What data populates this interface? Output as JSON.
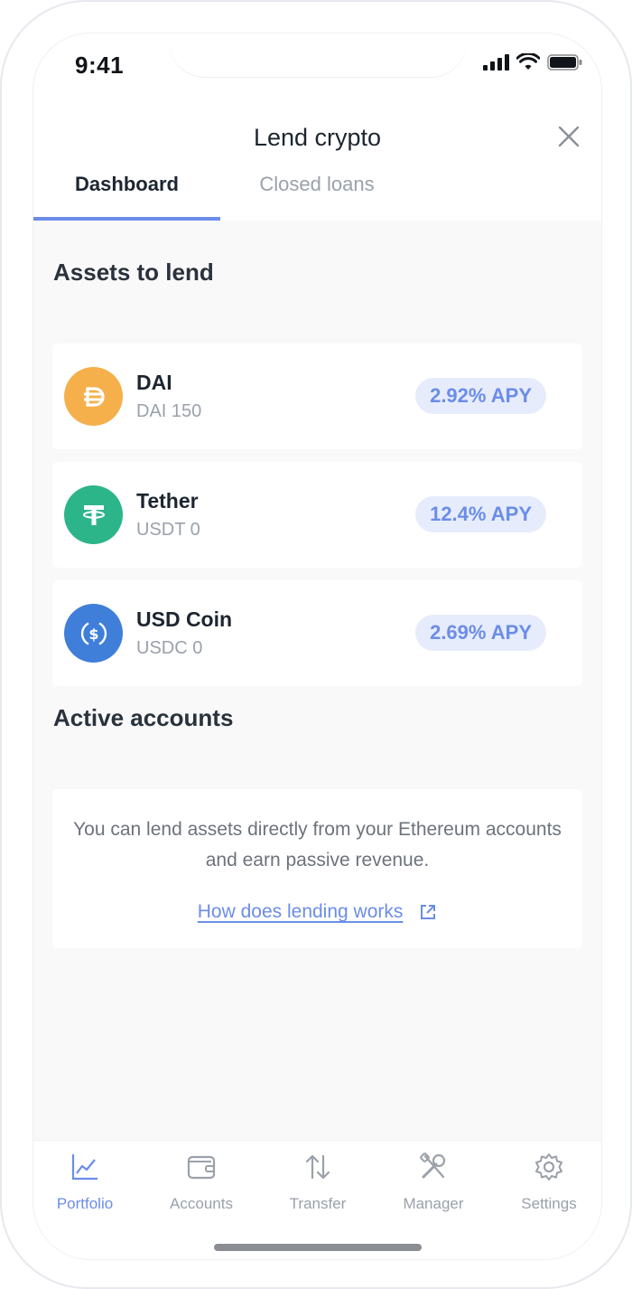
{
  "status_bar": {
    "time": "9:41"
  },
  "header": {
    "title": "Lend crypto",
    "tabs": [
      {
        "label": "Dashboard",
        "active": true
      },
      {
        "label": "Closed loans",
        "active": false
      }
    ]
  },
  "assets_section": {
    "title": "Assets to lend",
    "items": [
      {
        "name": "DAI",
        "balance": "DAI 150",
        "apy": "2.92% APY",
        "icon": "dai-icon",
        "color": "#f5b04c"
      },
      {
        "name": "Tether",
        "balance": "USDT 0",
        "apy": "12.4% APY",
        "icon": "tether-icon",
        "color": "#2db58a"
      },
      {
        "name": "USD Coin",
        "balance": "USDC 0",
        "apy": "2.69% APY",
        "icon": "usd-coin-icon",
        "color": "#3f7fd9"
      }
    ]
  },
  "active_section": {
    "title": "Active accounts",
    "description": "You can lend assets directly from your Ethereum accounts and earn passive revenue.",
    "link_label": "How does lending works"
  },
  "bottom_nav": {
    "items": [
      {
        "label": "Portfolio",
        "icon": "chart-icon",
        "active": true
      },
      {
        "label": "Accounts",
        "icon": "wallet-icon",
        "active": false
      },
      {
        "label": "Transfer",
        "icon": "transfer-arrows-icon",
        "active": false
      },
      {
        "label": "Manager",
        "icon": "tools-icon",
        "active": false
      },
      {
        "label": "Settings",
        "icon": "gear-icon",
        "active": false
      }
    ]
  },
  "colors": {
    "accent": "#6b8de8",
    "apy_badge_bg": "#e6ecfb",
    "content_bg": "#f9f9fa"
  }
}
